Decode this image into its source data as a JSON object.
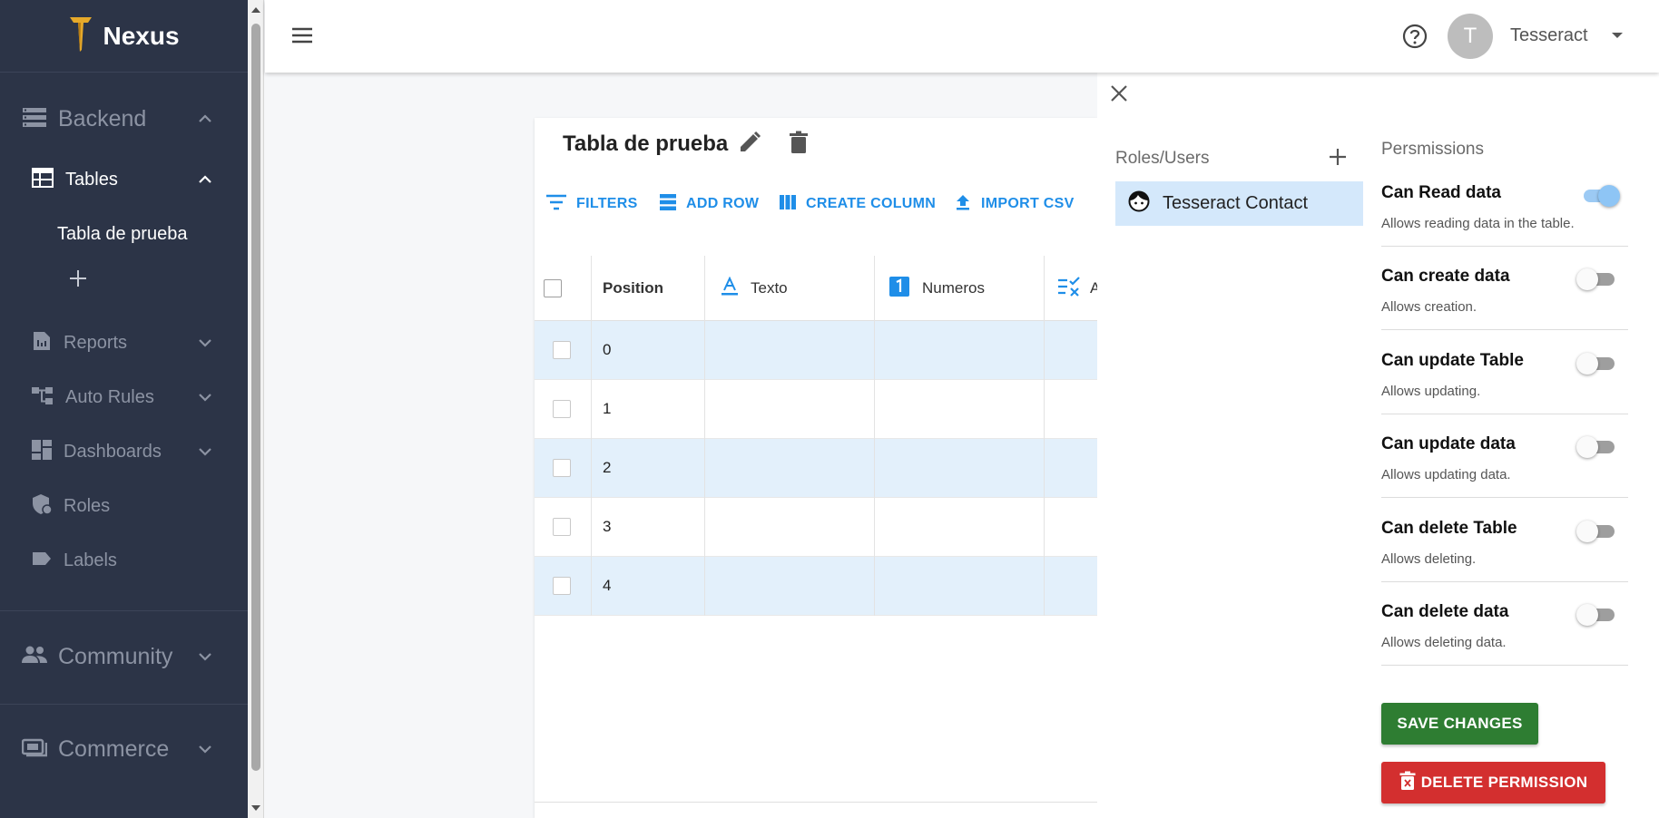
{
  "app": {
    "name": "Nexus",
    "logo_icon": "nexus-logo-icon"
  },
  "sidebar": {
    "backend": "Backend",
    "tables": "Tables",
    "table_items": [
      "Tabla de prueba"
    ],
    "reports": "Reports",
    "auto_rules": "Auto Rules",
    "dashboards": "Dashboards",
    "roles": "Roles",
    "labels": "Labels",
    "community": "Community",
    "commerce": "Commerce"
  },
  "topbar": {
    "avatar_letter": "T",
    "user_name": "Tesseract"
  },
  "table": {
    "title": "Tabla de prueba",
    "toolbar": {
      "filters": "FILTERS",
      "add_row": "ADD ROW",
      "create_column": "CREATE COLUMN",
      "import_csv": "IMPORT CSV"
    },
    "columns": [
      "Position",
      "Texto",
      "Numeros",
      "A"
    ],
    "column_icons": [
      "",
      "text-icon",
      "number-icon",
      "checklist-icon"
    ],
    "rows": [
      "0",
      "1",
      "2",
      "3",
      "4"
    ]
  },
  "panel": {
    "roles_title": "Roles/Users",
    "selected_user": "Tesseract Contact",
    "permissions_title": "Persmissions",
    "permissions": [
      {
        "name": "Can Read data",
        "desc": "Allows reading data in the table.",
        "enabled": true
      },
      {
        "name": "Can create data",
        "desc": "Allows creation.",
        "enabled": false
      },
      {
        "name": "Can update Table",
        "desc": "Allows updating.",
        "enabled": false
      },
      {
        "name": "Can update data",
        "desc": "Allows updating data.",
        "enabled": false
      },
      {
        "name": "Can delete Table",
        "desc": "Allows deleting.",
        "enabled": false
      },
      {
        "name": "Can delete data",
        "desc": "Allows deleting data.",
        "enabled": false
      }
    ],
    "save_label": "SAVE CHANGES",
    "delete_label": "DELETE PERMISSION"
  },
  "colors": {
    "sidebar_bg": "#2c3447",
    "accent_blue": "#1f8ee8",
    "row_highlight": "#e3f0fb",
    "save_green": "#2e7d32",
    "delete_red": "#d32f2f"
  }
}
